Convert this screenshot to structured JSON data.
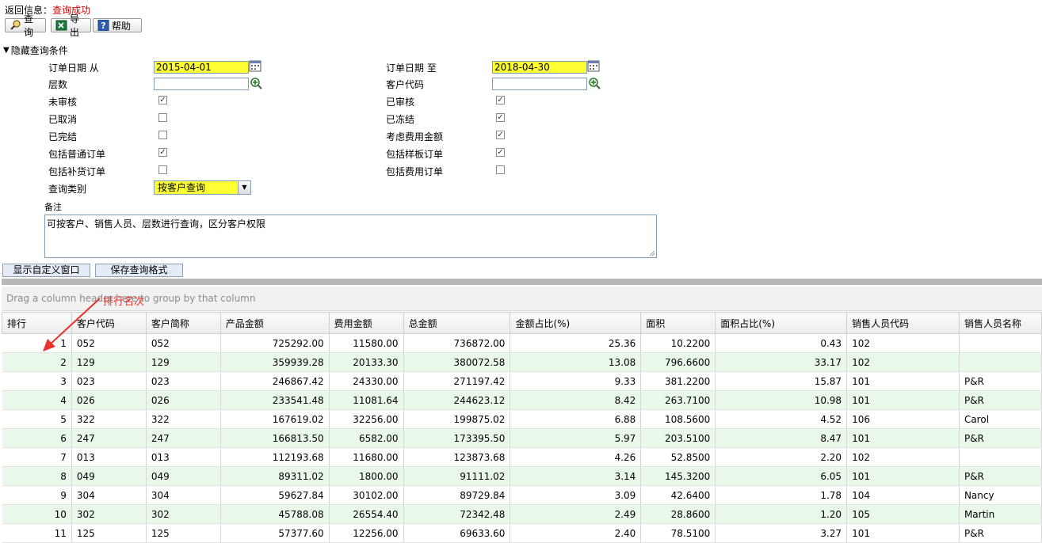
{
  "status": {
    "label": "返回信息：",
    "value": "查询成功"
  },
  "toolbar": {
    "query": "查询",
    "export": "导出",
    "help": "帮助"
  },
  "toggle_label": "隐藏查询条件",
  "form": {
    "date_from_label": "订单日期 从",
    "date_from_value": "2015-04-01",
    "date_to_label": "订单日期 至",
    "date_to_value": "2018-04-30",
    "level_label": "层数",
    "level_value": "",
    "customer_code_label": "客户代码",
    "customer_code_value": "",
    "checks": [
      {
        "label": "未审核",
        "checked": true
      },
      {
        "label": "已审核",
        "checked": true
      },
      {
        "label": "已取消",
        "checked": false
      },
      {
        "label": "已冻结",
        "checked": true
      },
      {
        "label": "已完结",
        "checked": false
      },
      {
        "label": "考虑费用金额",
        "checked": true
      },
      {
        "label": "包括普通订单",
        "checked": true
      },
      {
        "label": "包括样板订单",
        "checked": true
      },
      {
        "label": "包括补货订单",
        "checked": false
      },
      {
        "label": "包括费用订单",
        "checked": false
      }
    ],
    "query_type_label": "查询类别",
    "query_type_value": "按客户查询",
    "remark_label": "备注",
    "remark_value": "可按客户、销售人员、层数进行查询，区分客户权限"
  },
  "buttons": {
    "show_custom_window": "显示自定义窗口",
    "save_query_format": "保存查询格式"
  },
  "group_hint": "Drag a column header here to group by that column",
  "annotation": "排行名次",
  "table": {
    "columns": [
      "排行",
      "客户代码",
      "客户简称",
      "产品金额",
      "费用金额",
      "总金额",
      "金额占比(%)",
      "面积",
      "面积占比(%)",
      "销售人员代码",
      "销售人员名称"
    ],
    "rows": [
      [
        "1",
        "052",
        "052",
        "725292.00",
        "11580.00",
        "736872.00",
        "25.36",
        "10.2200",
        "0.43",
        "102",
        ""
      ],
      [
        "2",
        "129",
        "129",
        "359939.28",
        "20133.30",
        "380072.58",
        "13.08",
        "796.6600",
        "33.17",
        "102",
        ""
      ],
      [
        "3",
        "023",
        "023",
        "246867.42",
        "24330.00",
        "271197.42",
        "9.33",
        "381.2200",
        "15.87",
        "101",
        "P&R"
      ],
      [
        "4",
        "026",
        "026",
        "233541.48",
        "11081.64",
        "244623.12",
        "8.42",
        "263.7100",
        "10.98",
        "101",
        "P&R"
      ],
      [
        "5",
        "322",
        "322",
        "167619.02",
        "32256.00",
        "199875.02",
        "6.88",
        "108.5600",
        "4.52",
        "106",
        "Carol"
      ],
      [
        "6",
        "247",
        "247",
        "166813.50",
        "6582.00",
        "173395.50",
        "5.97",
        "203.5100",
        "8.47",
        "101",
        "P&R"
      ],
      [
        "7",
        "013",
        "013",
        "112193.68",
        "11680.00",
        "123873.68",
        "4.26",
        "52.8500",
        "2.20",
        "102",
        ""
      ],
      [
        "8",
        "049",
        "049",
        "89311.02",
        "1800.00",
        "91111.02",
        "3.14",
        "145.3200",
        "6.05",
        "101",
        "P&R"
      ],
      [
        "9",
        "304",
        "304",
        "59627.84",
        "30102.00",
        "89729.84",
        "3.09",
        "42.6400",
        "1.78",
        "104",
        "Nancy"
      ],
      [
        "10",
        "302",
        "302",
        "45788.08",
        "26554.40",
        "72342.48",
        "2.49",
        "28.8600",
        "1.20",
        "105",
        "Martin"
      ],
      [
        "11",
        "125",
        "125",
        "57377.60",
        "12256.00",
        "69633.60",
        "2.40",
        "78.5100",
        "3.27",
        "101",
        "P&R"
      ]
    ]
  },
  "colors": {
    "required_field": "#ffff33",
    "status_value": "#cc0000",
    "annotation": "#e8322a",
    "alt_row": "#eaf8ea"
  }
}
